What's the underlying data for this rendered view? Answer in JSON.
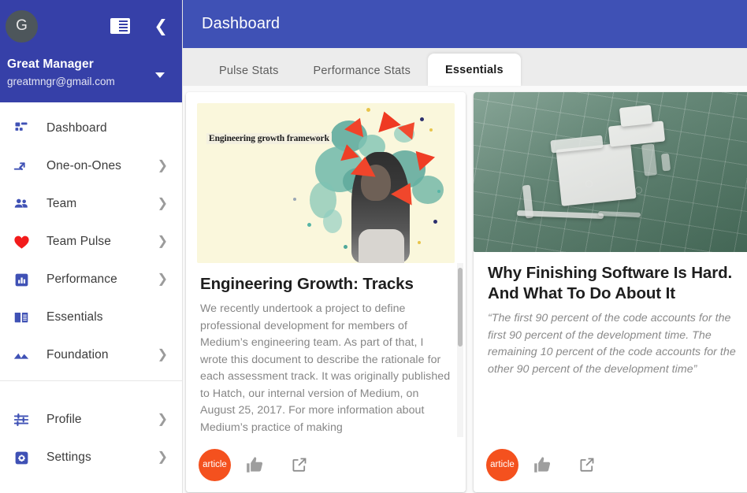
{
  "sidebar": {
    "avatar_initial": "G",
    "user_name": "Great Manager",
    "user_email": "greatmngr@gmail.com",
    "reader_icon": "chrome-reader-mode-icon",
    "collapse_icon": "chevron-left-icon",
    "account_caret_icon": "caret-down-icon",
    "items": [
      {
        "label": "Dashboard",
        "icon": "dashboard-icon",
        "has_chevron": false
      },
      {
        "label": "One-on-Ones",
        "icon": "merge-type-icon",
        "has_chevron": true
      },
      {
        "label": "Team",
        "icon": "people-icon",
        "has_chevron": true
      },
      {
        "label": "Team Pulse",
        "icon": "heart-icon",
        "has_chevron": true
      },
      {
        "label": "Performance",
        "icon": "bar-chart-icon",
        "has_chevron": true
      },
      {
        "label": "Essentials",
        "icon": "book-icon",
        "has_chevron": false
      },
      {
        "label": "Foundation",
        "icon": "mountains-icon",
        "has_chevron": true
      }
    ],
    "bottom_items": [
      {
        "label": "Profile",
        "icon": "tune-icon",
        "has_chevron": true
      },
      {
        "label": "Settings",
        "icon": "settings-icon",
        "has_chevron": true
      }
    ]
  },
  "header": {
    "title": "Dashboard"
  },
  "tabs": [
    {
      "label": "Pulse Stats",
      "active": false
    },
    {
      "label": "Performance Stats",
      "active": false
    },
    {
      "label": "Essentials",
      "active": true
    }
  ],
  "cards": [
    {
      "image_caption": "Engineering growth framework",
      "image_alt": "engineering-growth-framework-collage",
      "title": "Engineering Growth: Tracks",
      "text": "We recently undertook a project to define professional development for members of Medium’s engineering team. As part of that, I wrote this document to describe the rationale for each assessment track. It was originally published to Hatch, our internal version of Medium, on August 25, 2017. For more information about Medium’s practice of making",
      "text_italic": false,
      "has_scrollbar": true,
      "badge": "article",
      "like_icon": "thumb-up-icon",
      "open_icon": "open-in-new-icon"
    },
    {
      "image_caption": "",
      "image_alt": "green-jigsaw-puzzle-missing-pieces",
      "title": "Why Finishing Software Is Hard. And What To Do About It",
      "text": "“The first 90 percent of the code accounts for the first 90 percent of the development time. The remaining 10 percent of the code accounts for the other 90 percent of the development time”",
      "text_italic": true,
      "has_scrollbar": false,
      "badge": "article",
      "like_icon": "thumb-up-icon",
      "open_icon": "open-in-new-icon"
    }
  ],
  "colors": {
    "sidebar_header_blue": "#3640a8",
    "topbar_blue": "#3f51b5",
    "nav_icon_blue": "#3f51b5",
    "heart_red": "#f21b1b",
    "badge_orange": "#f4511e",
    "tabbar_grey": "#ececec",
    "page_grey": "#fafafa"
  }
}
